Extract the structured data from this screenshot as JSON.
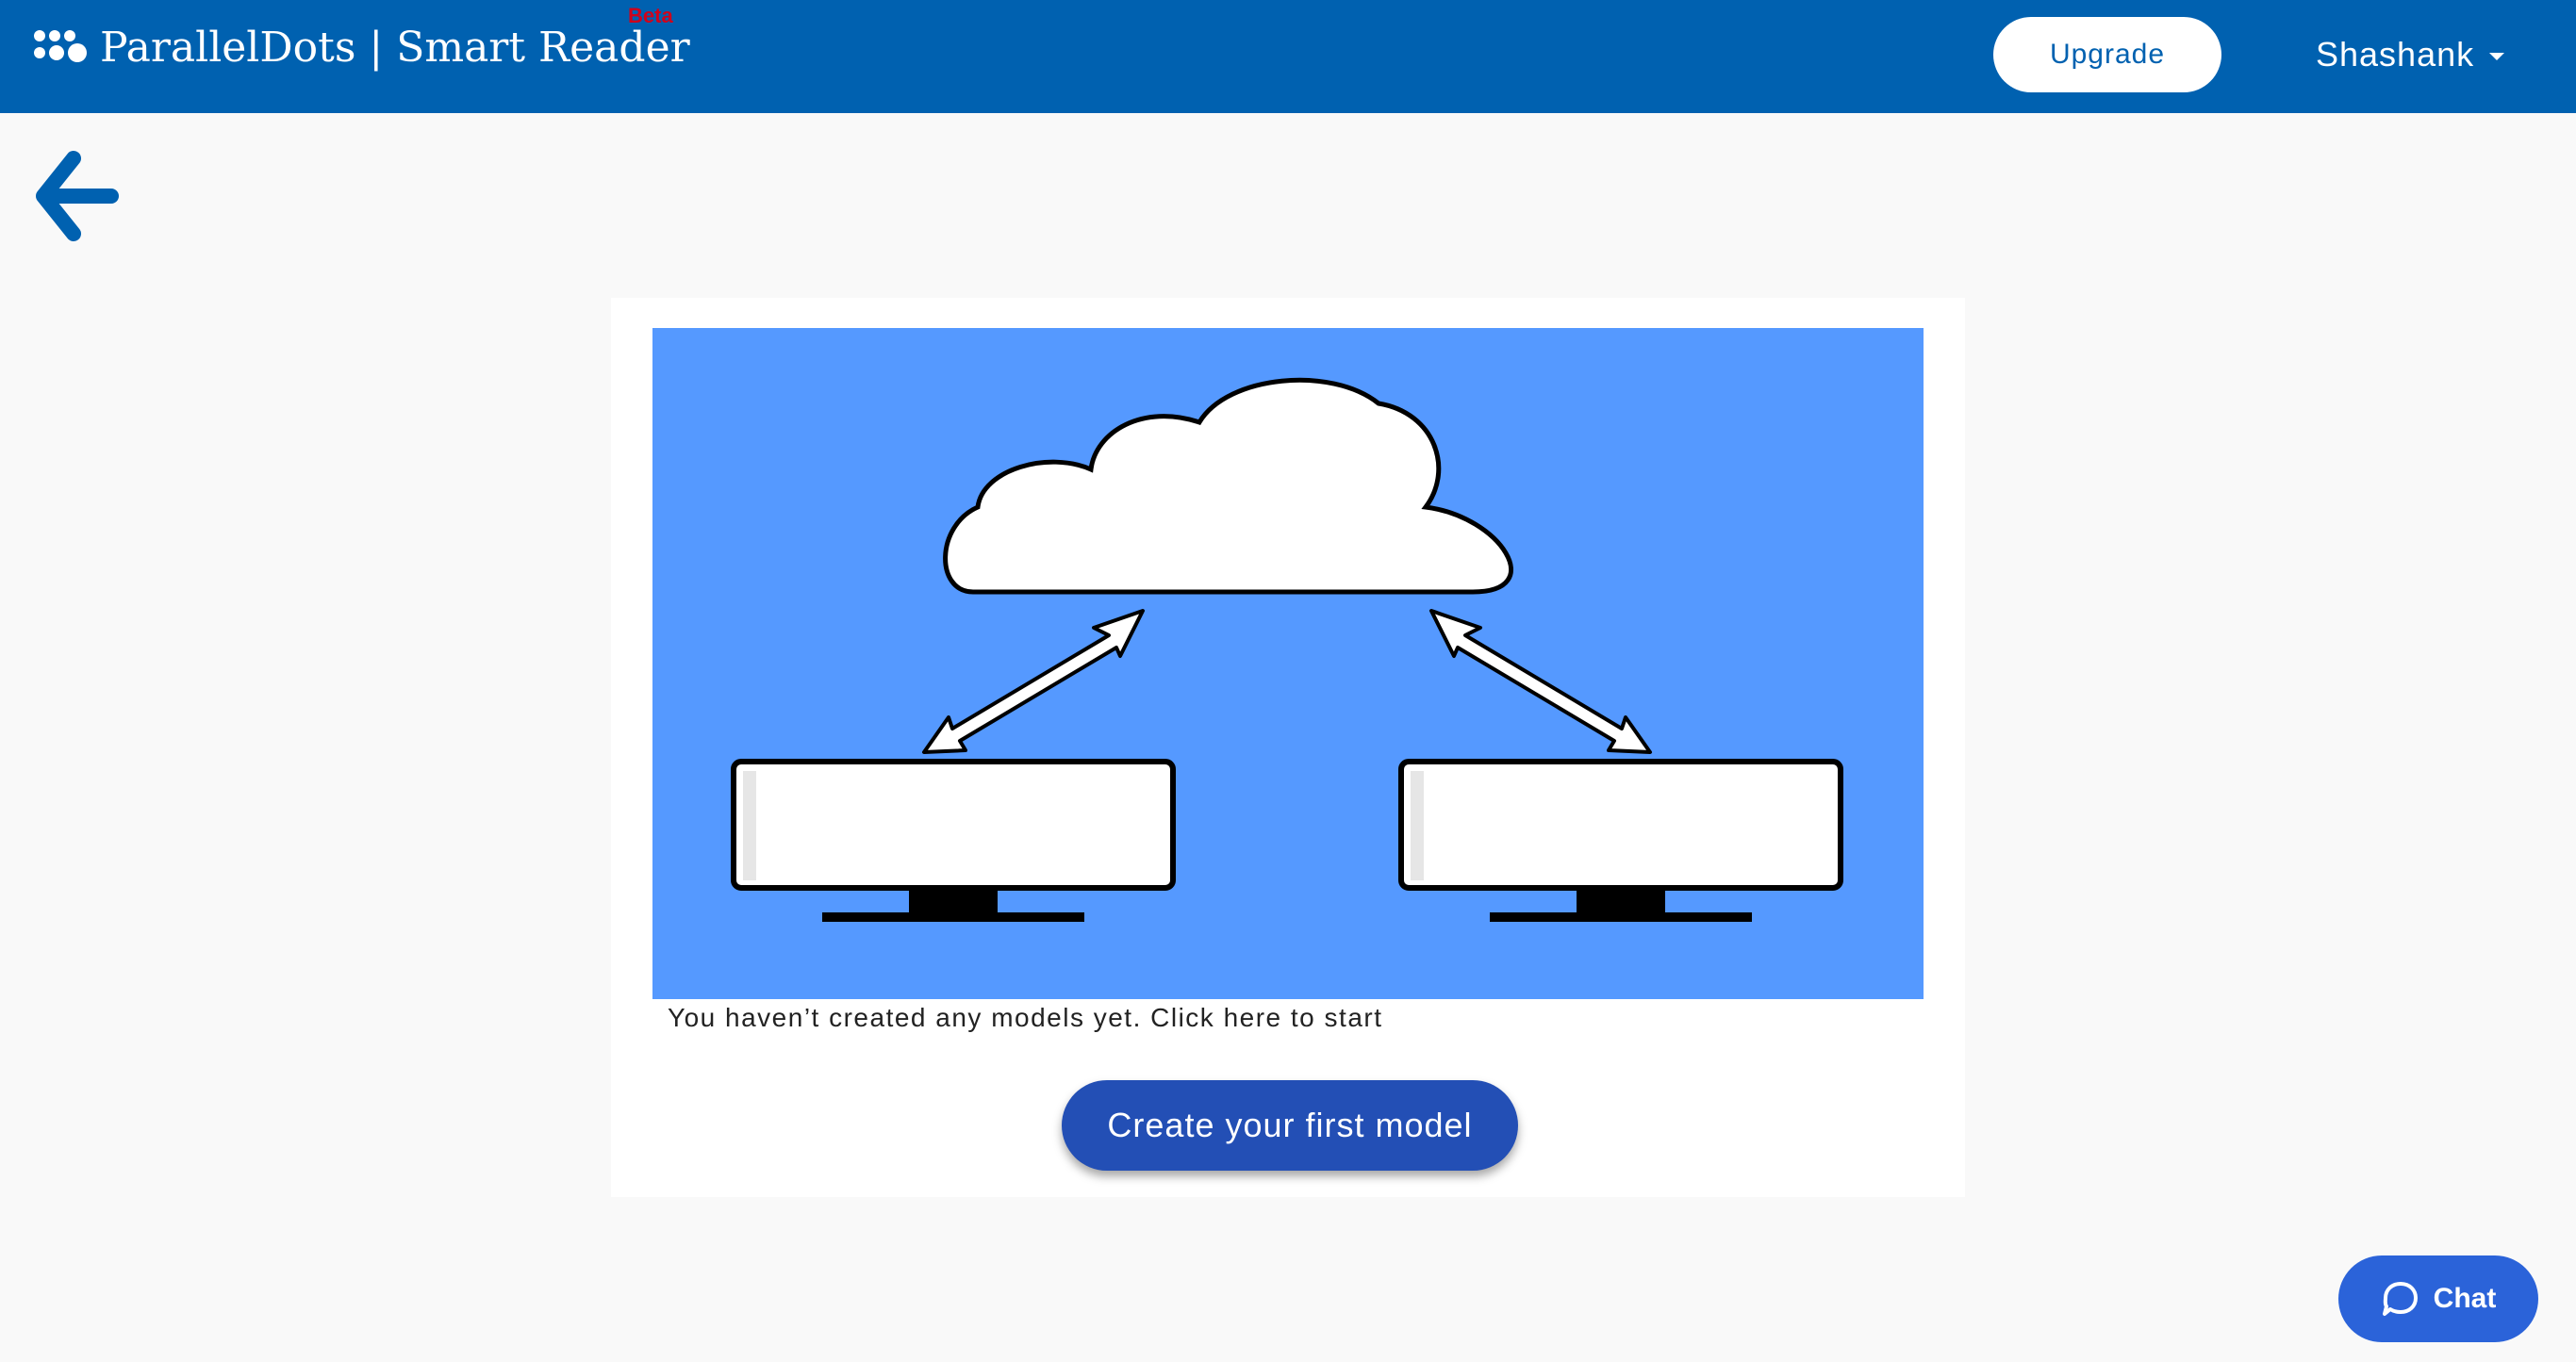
{
  "header": {
    "brand_name": "ParallelDots | Smart Reader",
    "brand_badge": "Beta",
    "upgrade_label": "Upgrade",
    "user_name": "Shashank",
    "background_color": "#0061b0"
  },
  "back": {
    "icon": "arrow-left-icon"
  },
  "main": {
    "empty_message": "You haven’t created any models yet. Click here to start",
    "create_button_label": "Create your first model",
    "illustration_icon": "cloud-sync-icon"
  },
  "chat": {
    "label": "Chat",
    "icon": "chat-bubble-icon"
  },
  "colors": {
    "accent": "#234fb5",
    "brand": "#0061b0",
    "beta": "#d0021b",
    "illustration_bg": "#5599ff"
  }
}
